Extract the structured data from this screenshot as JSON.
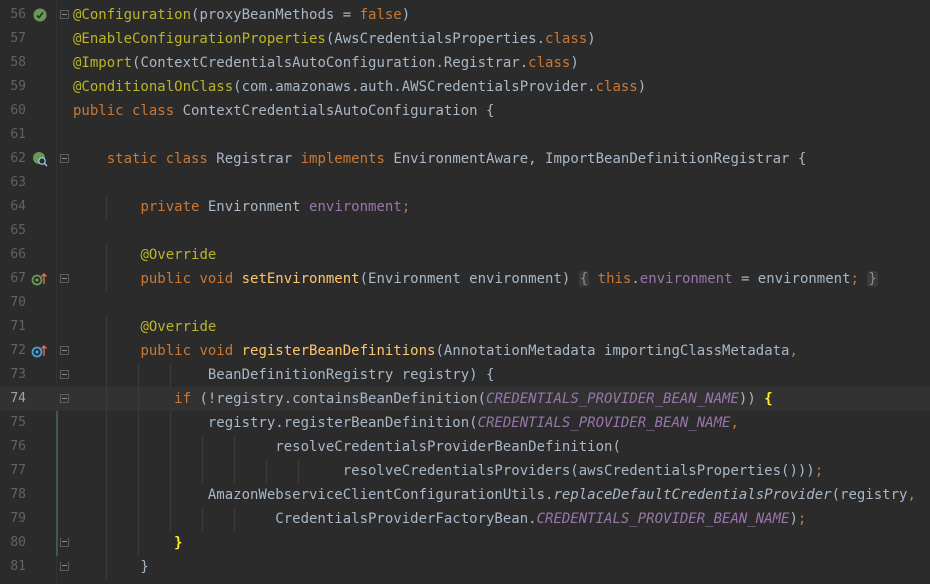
{
  "lines": [
    {
      "n": "56",
      "segs": [
        {
          "t": "@Configuration",
          "c": "ann"
        },
        {
          "t": "(proxyBeanMethods = "
        },
        {
          "t": "false",
          "c": "kw"
        },
        {
          "t": ")"
        }
      ]
    },
    {
      "n": "57",
      "segs": [
        {
          "t": "@EnableConfigurationProperties",
          "c": "ann"
        },
        {
          "t": "(AwsCredentialsProperties."
        },
        {
          "t": "class",
          "c": "kw"
        },
        {
          "t": ")"
        }
      ]
    },
    {
      "n": "58",
      "segs": [
        {
          "t": "@Import",
          "c": "ann"
        },
        {
          "t": "(ContextCredentialsAutoConfiguration.Registrar."
        },
        {
          "t": "class",
          "c": "kw"
        },
        {
          "t": ")"
        }
      ]
    },
    {
      "n": "59",
      "segs": [
        {
          "t": "@ConditionalOnClass",
          "c": "ann"
        },
        {
          "t": "(com.amazonaws.auth.AWSCredentialsProvider."
        },
        {
          "t": "class",
          "c": "kw"
        },
        {
          "t": ")"
        }
      ]
    },
    {
      "n": "60",
      "segs": [
        {
          "t": "public class ",
          "c": "kw"
        },
        {
          "t": "ContextCredentialsAutoConfiguration {"
        }
      ]
    },
    {
      "n": "61",
      "segs": []
    },
    {
      "n": "62",
      "segs": [
        {
          "t": "    "
        },
        {
          "t": "static class ",
          "c": "kw"
        },
        {
          "t": "Registrar "
        },
        {
          "t": "implements ",
          "c": "kw"
        },
        {
          "t": "EnvironmentAware, ImportBeanDefinitionRegistrar {"
        }
      ]
    },
    {
      "n": "63",
      "segs": []
    },
    {
      "n": "64",
      "segs": [
        {
          "t": "        "
        },
        {
          "t": "private ",
          "c": "kw"
        },
        {
          "t": "Environment "
        },
        {
          "t": "environment",
          "c": "fld"
        },
        {
          "t": ";",
          "c": "kw"
        }
      ]
    },
    {
      "n": "65",
      "segs": []
    },
    {
      "n": "66",
      "segs": [
        {
          "t": "        "
        },
        {
          "t": "@Override",
          "c": "ann"
        }
      ]
    },
    {
      "n": "67",
      "segs": [
        {
          "t": "        "
        },
        {
          "t": "public void ",
          "c": "kw"
        },
        {
          "t": "setEnvironment",
          "c": "fn"
        },
        {
          "t": "(Environment environment) "
        },
        {
          "t": "{",
          "c": "fpl"
        },
        {
          "t": " "
        },
        {
          "t": "this",
          "c": "kw"
        },
        {
          "t": "."
        },
        {
          "t": "environment",
          "c": "fld"
        },
        {
          "t": " = environment"
        },
        {
          "t": ";",
          "c": "kw"
        },
        {
          "t": " "
        },
        {
          "t": "}",
          "c": "fpl"
        }
      ]
    },
    {
      "n": "70",
      "segs": []
    },
    {
      "n": "71",
      "segs": [
        {
          "t": "        "
        },
        {
          "t": "@Override",
          "c": "ann"
        }
      ]
    },
    {
      "n": "72",
      "segs": [
        {
          "t": "        "
        },
        {
          "t": "public void ",
          "c": "kw"
        },
        {
          "t": "registerBeanDefinitions",
          "c": "fn"
        },
        {
          "t": "(AnnotationMetadata importingClassMetadata"
        },
        {
          "t": ",",
          "c": "kw"
        }
      ]
    },
    {
      "n": "73",
      "segs": [
        {
          "t": "                BeanDefinitionRegistry registry) {"
        }
      ]
    },
    {
      "n": "74",
      "segs": [
        {
          "t": "            "
        },
        {
          "t": "if ",
          "c": "kw"
        },
        {
          "t": "(!registry.containsBeanDefinition("
        },
        {
          "t": "CREDENTIALS_PROVIDER_BEAN_NAME",
          "c": "sfld"
        },
        {
          "t": ")) "
        },
        {
          "t": "{",
          "c": "br"
        }
      ]
    },
    {
      "n": "75",
      "segs": [
        {
          "t": "                registry.registerBeanDefinition("
        },
        {
          "t": "CREDENTIALS_PROVIDER_BEAN_NAME",
          "c": "sfld"
        },
        {
          "t": ",",
          "c": "kw"
        }
      ]
    },
    {
      "n": "76",
      "segs": [
        {
          "t": "                        resolveCredentialsProviderBeanDefinition("
        }
      ]
    },
    {
      "n": "77",
      "segs": [
        {
          "t": "                                resolveCredentialsProviders(awsCredentialsProperties()))"
        },
        {
          "t": ";",
          "c": "kw"
        }
      ]
    },
    {
      "n": "78",
      "segs": [
        {
          "t": "                AmazonWebserviceClientConfigurationUtils."
        },
        {
          "t": "replaceDefaultCredentialsProvider",
          "c": "smth"
        },
        {
          "t": "(registry"
        },
        {
          "t": ",",
          "c": "kw"
        }
      ]
    },
    {
      "n": "79",
      "segs": [
        {
          "t": "                        CredentialsProviderFactoryBean."
        },
        {
          "t": "CREDENTIALS_PROVIDER_BEAN_NAME",
          "c": "sfld"
        },
        {
          "t": ")"
        },
        {
          "t": ";",
          "c": "kw"
        }
      ]
    },
    {
      "n": "80",
      "segs": [
        {
          "t": "            "
        },
        {
          "t": "}",
          "c": "br"
        }
      ]
    },
    {
      "n": "81",
      "segs": [
        {
          "t": "        }"
        }
      ]
    }
  ],
  "gutter_icons": [
    {
      "line": "56",
      "name": "spring-bean-icon",
      "color": "#6a9955"
    },
    {
      "line": "62",
      "name": "spring-bean-search-icon",
      "color": "#6a9955"
    },
    {
      "line": "67",
      "name": "implements-method-icon",
      "color": "#6a9955"
    },
    {
      "line": "72",
      "name": "implements-method-icon",
      "color": "#4a9fd8"
    }
  ],
  "fold_markers": [
    "56",
    "62",
    "67",
    "72",
    "73",
    "74",
    "80",
    "81"
  ],
  "current_line": "74",
  "colors": {
    "background": "#2b2b2b",
    "current_line": "#323232",
    "keyword": "#cc7832",
    "annotation": "#bbb529",
    "field": "#9876aa",
    "method_decl": "#ffc66d",
    "plain": "#a9b7c6",
    "line_number": "#606366",
    "brace_match": "#ffef28"
  }
}
